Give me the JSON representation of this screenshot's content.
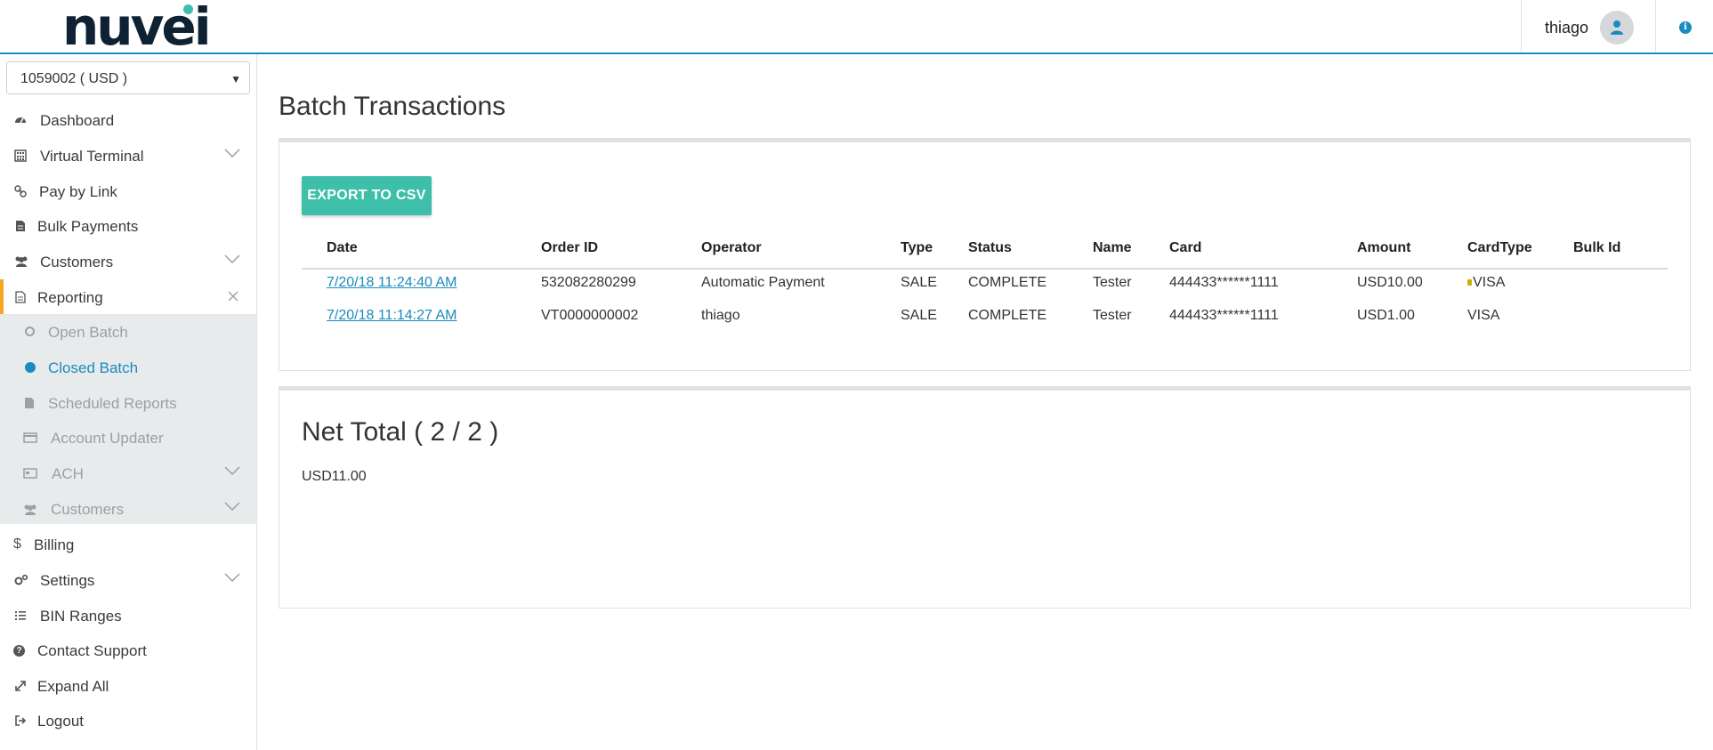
{
  "header": {
    "logo_text": "nuvei",
    "user_name": "thiago",
    "info_icon": "info-icon"
  },
  "sidebar": {
    "merchant_select": {
      "value": "1059002 ( USD )"
    },
    "items": [
      {
        "label": "Dashboard",
        "icon": "dashboard-icon"
      },
      {
        "label": "Virtual Terminal",
        "icon": "calculator-icon",
        "expandable": true
      },
      {
        "label": "Pay by Link",
        "icon": "link-icon"
      },
      {
        "label": "Bulk Payments",
        "icon": "file-icon"
      },
      {
        "label": "Customers",
        "icon": "users-icon",
        "expandable": true
      },
      {
        "label": "Reporting",
        "icon": "report-icon",
        "expanded": true
      },
      {
        "label": "Billing",
        "icon": "dollar-icon"
      },
      {
        "label": "Settings",
        "icon": "gears-icon",
        "expandable": true
      },
      {
        "label": "BIN Ranges",
        "icon": "list-icon"
      },
      {
        "label": "Contact Support",
        "icon": "question-icon"
      },
      {
        "label": "Expand All",
        "icon": "expand-icon"
      },
      {
        "label": "Logout",
        "icon": "logout-icon"
      }
    ],
    "reporting_sub": [
      {
        "label": "Open Batch"
      },
      {
        "label": "Closed Batch",
        "selected": true
      },
      {
        "label": "Scheduled Reports"
      },
      {
        "label": "Account Updater"
      },
      {
        "label": "ACH",
        "expandable": true
      },
      {
        "label": "Customers",
        "expandable": true
      }
    ]
  },
  "main": {
    "title": "Batch Transactions",
    "export_label": "EXPORT TO CSV",
    "columns": [
      "Date",
      "Order ID",
      "Operator",
      "Type",
      "Status",
      "Name",
      "Card",
      "Amount",
      "CardType",
      "Bulk Id"
    ],
    "rows": [
      {
        "date": "7/20/18 11:24:40 AM",
        "order_id": "532082280299",
        "operator": "Automatic Payment",
        "type": "SALE",
        "status": "COMPLETE",
        "name": "Tester",
        "card": "444433******1111",
        "amount": "USD10.00",
        "card_type": "VISA",
        "bulk_id": ""
      },
      {
        "date": "7/20/18 11:14:27 AM",
        "order_id": "VT0000000002",
        "operator": "thiago",
        "type": "SALE",
        "status": "COMPLETE",
        "name": "Tester",
        "card": "444433******1111",
        "amount": "USD1.00",
        "card_type": "VISA",
        "bulk_id": ""
      }
    ],
    "net_total_title": "Net Total ( 2 / 2 )",
    "net_total_value": "USD11.00"
  },
  "colors": {
    "accent": "#1a8bbf",
    "export_button": "#3ebfa9",
    "active_marker": "#f5a623",
    "submenu_bg": "#e7ebec"
  }
}
